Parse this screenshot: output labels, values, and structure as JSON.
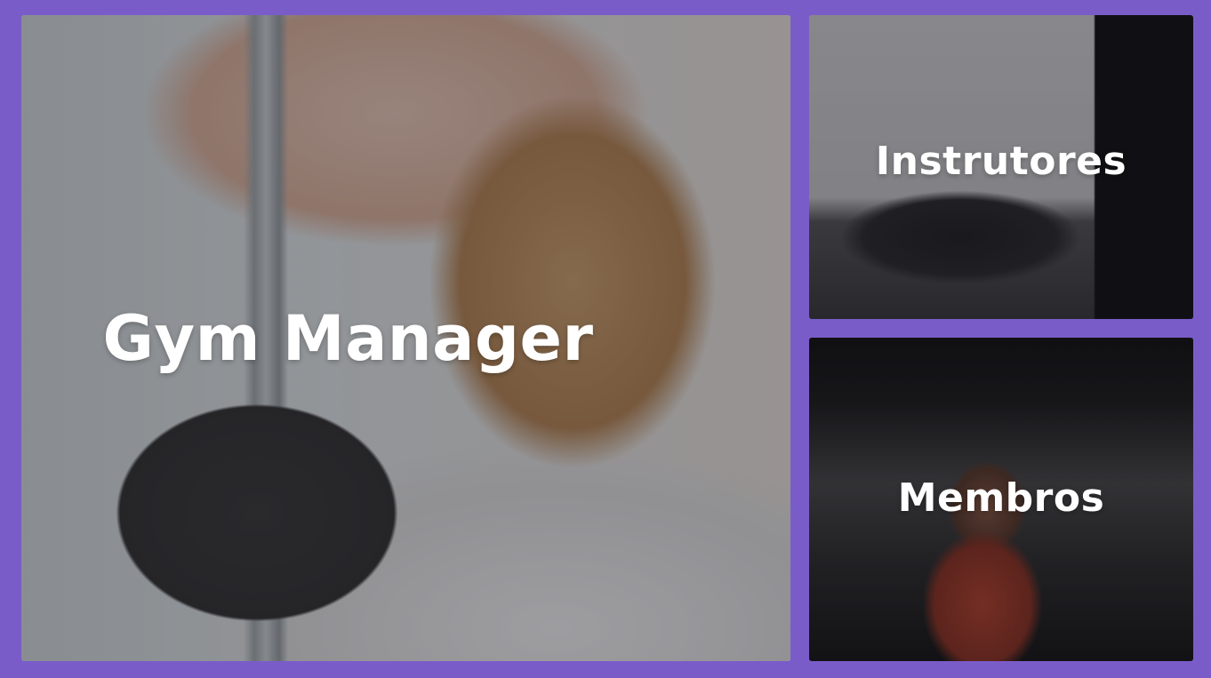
{
  "theme": {
    "background": "#7a5cc9",
    "label_color": "#ffffff"
  },
  "main_card": {
    "title": "Gym Manager",
    "image": "woman-holding-dumbbell-photo"
  },
  "side_cards": [
    {
      "label": "Instrutores",
      "image": "group-stretching-photo"
    },
    {
      "label": "Membros",
      "image": "man-training-gym-photo"
    }
  ]
}
